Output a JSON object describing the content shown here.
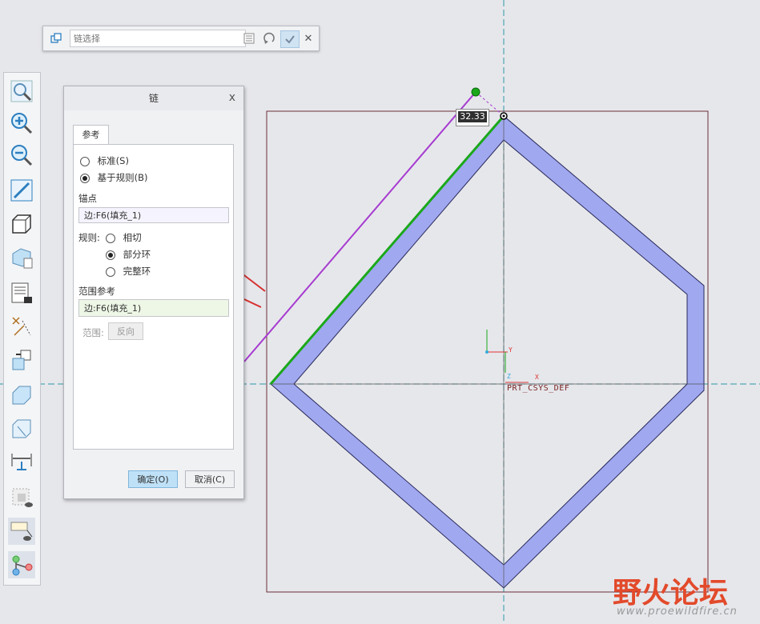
{
  "chain_bar": {
    "placeholder": "链选择"
  },
  "viewport": {
    "dimension_value": "32.33",
    "csys_label": "PRT_CSYS_DEF",
    "axis_x": "X",
    "axis_y": "Y",
    "axis_z": "Z"
  },
  "dialog": {
    "title": "链",
    "close": "x",
    "tab": "参考",
    "option_standard": "标准(S)",
    "option_rule": "基于规则(B)",
    "anchor_label": "锚点",
    "anchor_value": "边:F6(填充_1)",
    "rule_label": "规则:",
    "rule_tangent": "相切",
    "rule_partial": "部分环",
    "rule_complete": "完整环",
    "range_ref_label": "范围参考",
    "range_ref_value": "边:F6(填充_1)",
    "range_label": "范围:",
    "reverse_button": "反向",
    "ok_button": "确定(O)",
    "cancel_button": "取消(C)"
  },
  "watermark": {
    "title": "野火论坛",
    "url": "www.proewildfire.cn"
  },
  "colors": {
    "shape_fill": "#a0a8f0",
    "highlight_green": "#1aa81a",
    "preview_purple": "#a63ad0",
    "arrow_red": "#d63030",
    "ok_button": "#bfe1f7"
  }
}
